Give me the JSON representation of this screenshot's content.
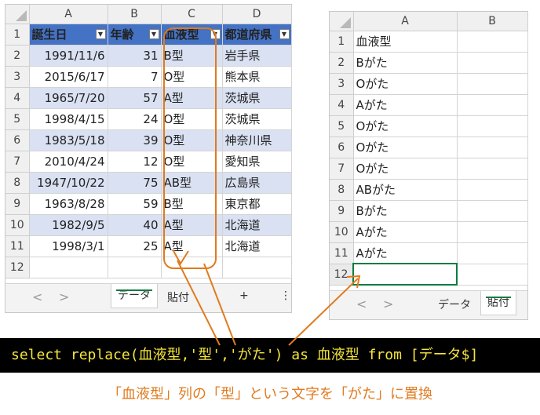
{
  "left_sheet": {
    "col_headers": [
      "A",
      "B",
      "C",
      "D"
    ],
    "row_numbers": [
      "1",
      "2",
      "3",
      "4",
      "5",
      "6",
      "7",
      "8",
      "9",
      "10",
      "11",
      "12"
    ],
    "table_headers": [
      "誕生日",
      "年齢",
      "血液型",
      "都道府県"
    ],
    "rows": [
      [
        "1991/11/6",
        "31",
        "B型",
        "岩手県"
      ],
      [
        "2015/6/17",
        "7",
        "O型",
        "熊本県"
      ],
      [
        "1965/7/20",
        "57",
        "A型",
        "茨城県"
      ],
      [
        "1998/4/15",
        "24",
        "O型",
        "茨城県"
      ],
      [
        "1983/5/18",
        "39",
        "O型",
        "神奈川県"
      ],
      [
        "2010/4/24",
        "12",
        "O型",
        "愛知県"
      ],
      [
        "1947/10/22",
        "75",
        "AB型",
        "広島県"
      ],
      [
        "1963/8/28",
        "59",
        "B型",
        "東京都"
      ],
      [
        "1982/9/5",
        "40",
        "A型",
        "北海道"
      ],
      [
        "1998/3/1",
        "25",
        "A型",
        "北海道"
      ]
    ],
    "tabs": {
      "prev": "<",
      "next": ">",
      "sheet1": "データ",
      "sheet2": "貼付",
      "add": "+",
      "more": "⋮"
    }
  },
  "right_sheet": {
    "col_headers": [
      "A",
      "B"
    ],
    "row_numbers": [
      "1",
      "2",
      "3",
      "4",
      "5",
      "6",
      "7",
      "8",
      "9",
      "10",
      "11",
      "12"
    ],
    "cells": [
      "血液型",
      "Bがた",
      "Oがた",
      "Aがた",
      "Oがた",
      "Oがた",
      "Oがた",
      "ABがた",
      "Bがた",
      "Aがた",
      "Aがた"
    ],
    "tabs": {
      "prev": "<",
      "next": ">",
      "sheet1": "データ",
      "sheet2": "貼付"
    }
  },
  "sql": "select replace(血液型,'型','がた') as 血液型 from [データ$]",
  "caption": "「血液型」列の「型」という文字を「がた」に置換",
  "colors": {
    "table_header": "#4472c4",
    "band": "#d9e1f2",
    "annotation": "#e07b1f",
    "sql_text": "#f5e63c",
    "excel_green": "#107c41"
  }
}
